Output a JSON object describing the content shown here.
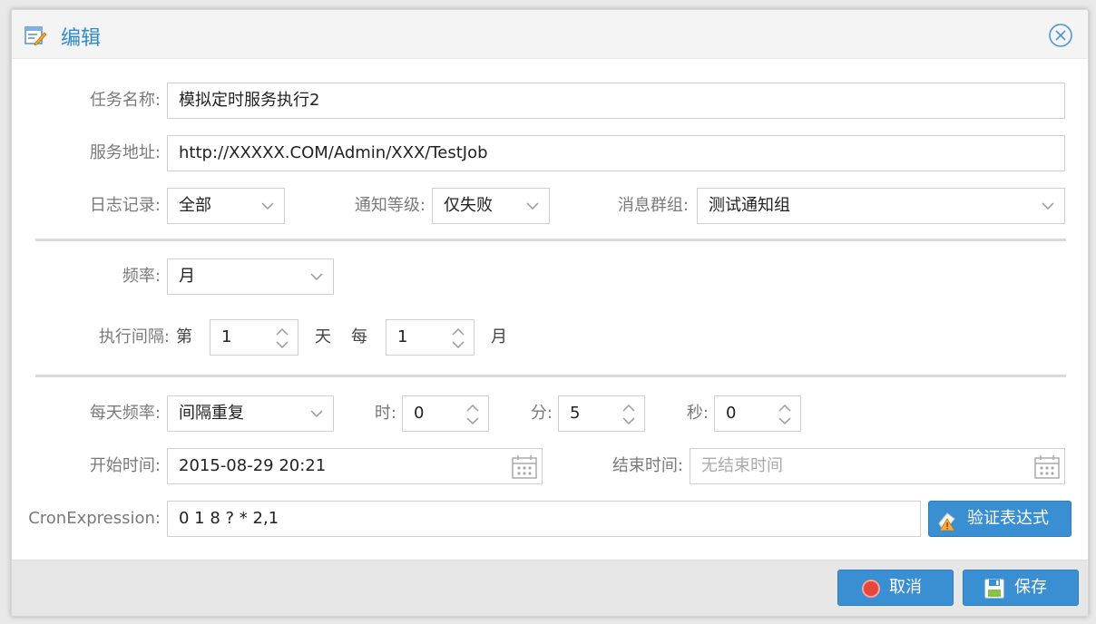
{
  "dialog": {
    "title": "编辑",
    "title_icon": "edit-form-icon",
    "close_icon": "close-circle-icon"
  },
  "form": {
    "task_name_label": "任务名称:",
    "task_name_value": "模拟定时服务执行2",
    "service_url_label": "服务地址:",
    "service_url_value": "http://XXXXX.COM/Admin/XXX/TestJob",
    "log_label": "日志记录:",
    "log_value": "全部",
    "notify_label": "通知等级:",
    "notify_value": "仅失败",
    "group_label": "消息群组:",
    "group_value": "测试通知组",
    "freq_label": "频率:",
    "freq_value": "月",
    "interval_label": "执行间隔:",
    "interval_prefix": "第",
    "interval_day_value": "1",
    "interval_day_unit": "天",
    "interval_every": "每",
    "interval_month_value": "1",
    "interval_month_unit": "月",
    "daily_freq_label": "每天频率:",
    "daily_freq_value": "间隔重复",
    "hour_label": "时:",
    "hour_value": "0",
    "minute_label": "分:",
    "minute_value": "5",
    "second_label": "秒:",
    "second_value": "0",
    "start_label": "开始时间:",
    "start_value": "2015-08-29 20:21",
    "end_label": "结束时间:",
    "end_placeholder": "无结束时间",
    "cron_label": "CronExpression:",
    "cron_value": "0 1 8 ? * 2,1",
    "validate_button": "验证表达式"
  },
  "footer": {
    "cancel_button": "取消",
    "save_button": "保存"
  },
  "colors": {
    "accent": "#3a8fd3",
    "title_text": "#2e8acd",
    "footer_bg": "#e6e6e6"
  }
}
